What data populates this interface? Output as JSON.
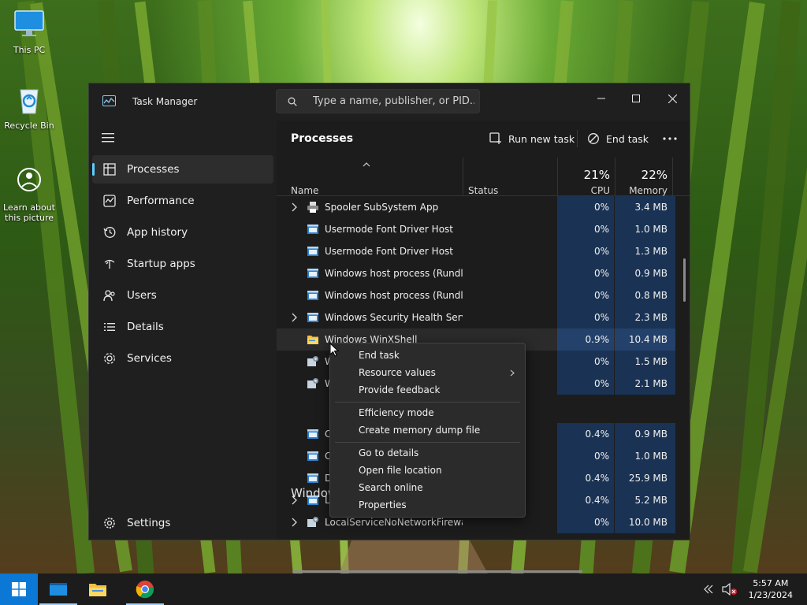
{
  "desktop": {
    "icons": [
      {
        "label": "This PC"
      },
      {
        "label": "Recycle Bin"
      },
      {
        "label_line1": "Learn about",
        "label_line2": "this picture"
      }
    ]
  },
  "window": {
    "title": "Task Manager",
    "search_placeholder": "Type a name, publisher, or PID..."
  },
  "sidebar": {
    "items": [
      {
        "label": "Processes",
        "icon": "processes-icon",
        "active": true
      },
      {
        "label": "Performance",
        "icon": "performance-icon"
      },
      {
        "label": "App history",
        "icon": "app-history-icon"
      },
      {
        "label": "Startup apps",
        "icon": "startup-apps-icon"
      },
      {
        "label": "Users",
        "icon": "users-icon"
      },
      {
        "label": "Details",
        "icon": "details-icon"
      },
      {
        "label": "Services",
        "icon": "services-icon"
      }
    ],
    "settings_label": "Settings"
  },
  "commandbar": {
    "page_title": "Processes",
    "run_new_task": "Run new task",
    "end_task": "End task"
  },
  "columns": {
    "name": "Name",
    "status": "Status",
    "cpu_pct": "21%",
    "cpu": "CPU",
    "memory_pct": "22%",
    "memory": "Memory"
  },
  "processes": [
    {
      "name": "Spooler SubSystem App",
      "expandable": true,
      "icon": "printer-icon",
      "cpu": "0%",
      "memory": "3.4 MB"
    },
    {
      "name": "Usermode Font Driver Host",
      "expandable": false,
      "icon": "app-window-icon",
      "cpu": "0%",
      "memory": "1.0 MB"
    },
    {
      "name": "Usermode Font Driver Host",
      "expandable": false,
      "icon": "app-window-icon",
      "cpu": "0%",
      "memory": "1.3 MB"
    },
    {
      "name": "Windows host process (Rundll...",
      "expandable": false,
      "icon": "app-window-icon",
      "cpu": "0%",
      "memory": "0.9 MB"
    },
    {
      "name": "Windows host process (Rundll...",
      "expandable": false,
      "icon": "app-window-icon",
      "cpu": "0%",
      "memory": "0.8 MB"
    },
    {
      "name": "Windows Security Health Servi...",
      "expandable": true,
      "icon": "app-window-icon",
      "cpu": "0%",
      "memory": "2.3 MB"
    },
    {
      "name": "Windows WinXShell",
      "expandable": false,
      "icon": "folder-icon",
      "cpu": "0.9%",
      "memory": "10.4 MB"
    },
    {
      "name": "W",
      "expandable": false,
      "icon": "service-icon",
      "cpu": "0%",
      "memory": "1.5 MB"
    },
    {
      "name": "W",
      "expandable": false,
      "icon": "service-icon",
      "cpu": "0%",
      "memory": "2.1 MB"
    }
  ],
  "group": {
    "label": "Window"
  },
  "windows_processes": [
    {
      "name": "C",
      "expandable": false,
      "icon": "app-window-icon",
      "cpu": "0.4%",
      "memory": "0.9 MB"
    },
    {
      "name": "C",
      "expandable": false,
      "icon": "app-window-icon",
      "cpu": "0%",
      "memory": "1.0 MB"
    },
    {
      "name": "D",
      "expandable": false,
      "icon": "app-window-icon",
      "cpu": "0.4%",
      "memory": "25.9 MB"
    },
    {
      "name": "L",
      "expandable": true,
      "icon": "app-window-icon",
      "cpu": "0.4%",
      "memory": "5.2 MB"
    },
    {
      "name": "LocalServiceNoNetworkFirewa...",
      "expandable": true,
      "icon": "service-icon",
      "cpu": "0%",
      "memory": "10.0 MB"
    }
  ],
  "context_menu": {
    "end_task": "End task",
    "resource_values": "Resource values",
    "provide_feedback": "Provide feedback",
    "efficiency_mode": "Efficiency mode",
    "create_dump": "Create memory dump file",
    "go_to_details": "Go to details",
    "open_file_location": "Open file location",
    "search_online": "Search online",
    "properties": "Properties"
  },
  "taskbar": {
    "time": "5:57 AM",
    "date": "1/23/2024"
  },
  "colors": {
    "accent": "#60cdff",
    "start_button": "#0a78d4",
    "heat_cell": "#1a3354"
  }
}
